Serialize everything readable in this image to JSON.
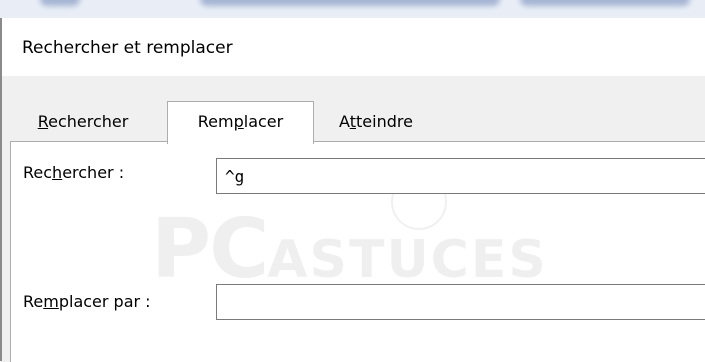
{
  "dialog": {
    "title": "Rechercher et remplacer"
  },
  "tabs": [
    {
      "pre": "",
      "key": "R",
      "post": "echercher",
      "active": false
    },
    {
      "pre": "Rem",
      "key": "p",
      "post": "lacer",
      "active": true
    },
    {
      "pre": "A",
      "key": "t",
      "post": "teindre",
      "active": false
    }
  ],
  "find": {
    "label_pre": "Rec",
    "label_key": "h",
    "label_post": "ercher :",
    "value": "^g"
  },
  "replace": {
    "label_pre": "Re",
    "label_key": "m",
    "label_post": "placer par :",
    "value": ""
  },
  "watermark": {
    "logo_initials": "PC",
    "logo_word": "ASTUCES"
  }
}
